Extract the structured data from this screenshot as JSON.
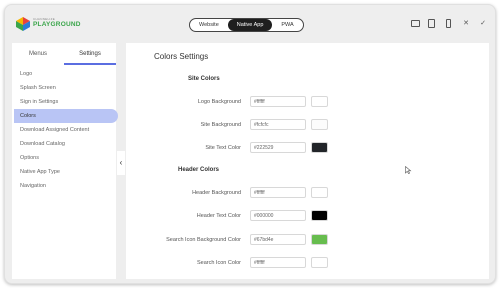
{
  "header": {
    "logo_small": "CHANNELIZE",
    "logo_text": "PLAYGROUND",
    "platforms": [
      "Website",
      "Native App",
      "PWA"
    ],
    "active_platform": "Native App",
    "icons": [
      "desktop-icon",
      "tablet-icon",
      "mobile-icon",
      "close-icon",
      "check-icon"
    ],
    "close_glyph": "✕",
    "check_glyph": "✓"
  },
  "sidebar": {
    "tabs": [
      "Menus",
      "Settings"
    ],
    "active_tab": "Settings",
    "items": [
      "Logo",
      "Splash Screen",
      "Sign in Settings",
      "Colors",
      "Download Assigned Content",
      "Download Catalog",
      "Options",
      "Native App Type",
      "Navigation"
    ],
    "active_item": "Colors",
    "collapse_glyph": "‹"
  },
  "main": {
    "title": "Colors Settings",
    "sections": [
      {
        "title": "Site Colors",
        "rows": [
          {
            "label": "Logo Background",
            "value": "#ffffff",
            "color": "#ffffff"
          },
          {
            "label": "Site Background",
            "value": "#fcfcfc",
            "color": "#fcfcfc"
          },
          {
            "label": "Site Text Color",
            "value": "#222529",
            "color": "#222529"
          }
        ]
      },
      {
        "title": "Header Colors",
        "rows": [
          {
            "label": "Header Background",
            "value": "#ffffff",
            "color": "#ffffff"
          },
          {
            "label": "Header Text Color",
            "value": "#000000",
            "color": "#000000"
          },
          {
            "label": "Search Icon Background Color",
            "value": "#67bd4e",
            "color": "#67bd4e"
          },
          {
            "label": "Search Icon Color",
            "value": "#ffffff",
            "color": "#ffffff"
          }
        ]
      }
    ]
  },
  "colors": {
    "accent": "#5b6ee1",
    "active_item_bg": "#b9c5f5",
    "brand_green": "#3aa54a"
  }
}
